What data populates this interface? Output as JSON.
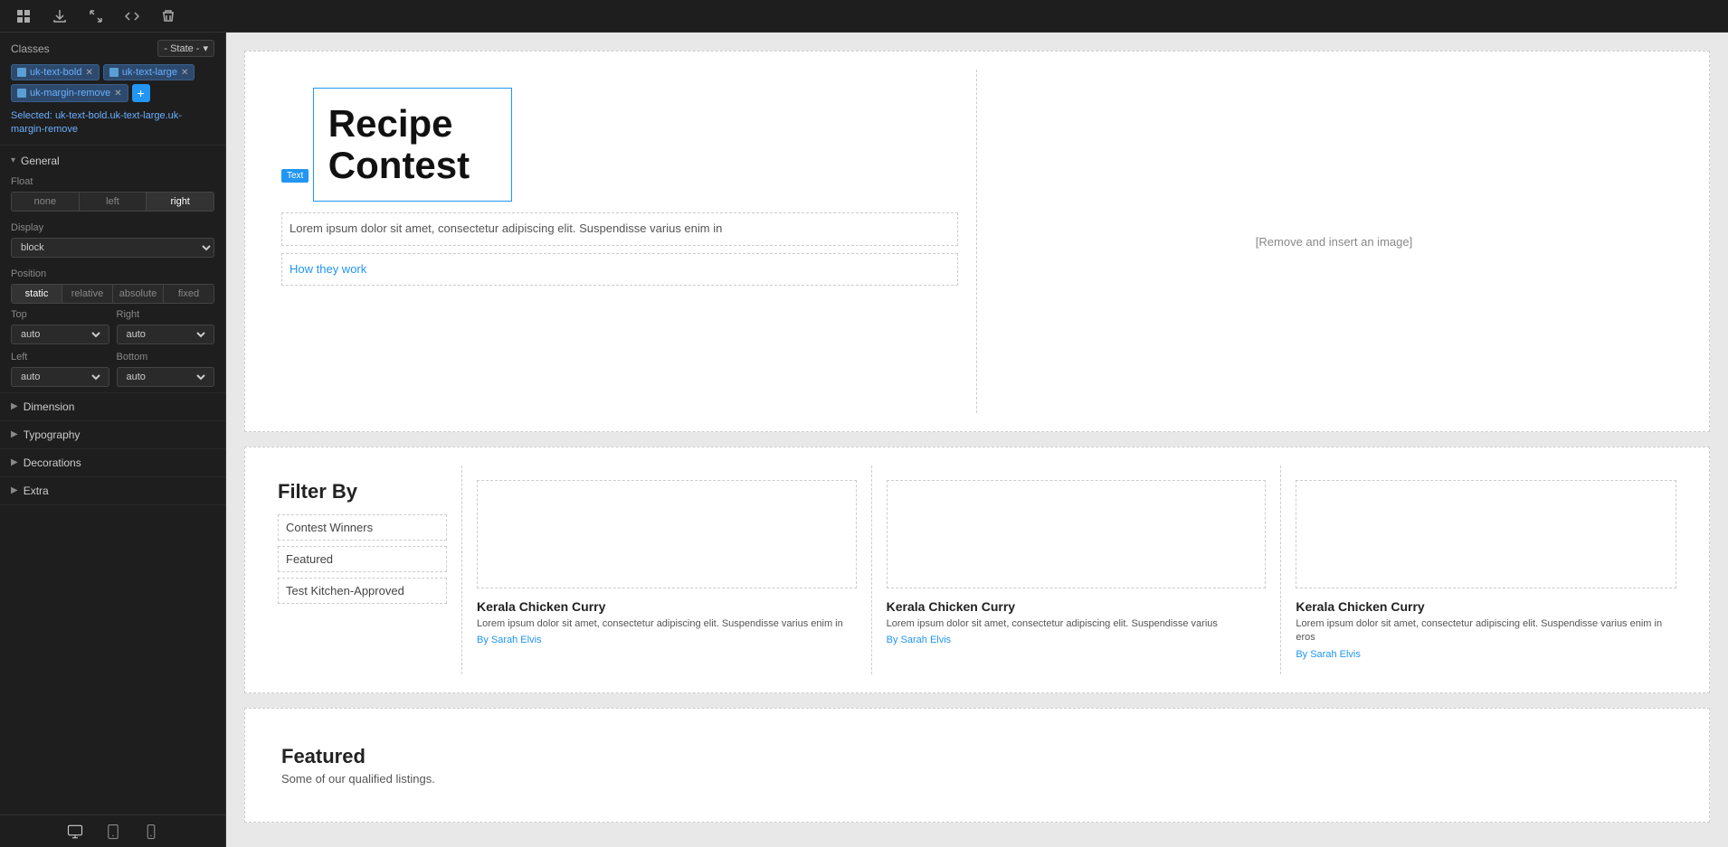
{
  "toolbar": {
    "icons": [
      "grid-icon",
      "export-icon",
      "expand-icon",
      "code-icon",
      "delete-icon"
    ]
  },
  "left_panel": {
    "classes_label": "Classes",
    "state_label": "- State -",
    "tags": [
      {
        "icon": true,
        "label": "uk-text-bold",
        "closeable": true
      },
      {
        "icon": true,
        "label": "uk-text-large",
        "closeable": true
      },
      {
        "icon": true,
        "label": "uk-margin-remove",
        "closeable": true
      }
    ],
    "add_button_label": "+",
    "selected_label": "Selected:",
    "selected_value": "uk-text-bold.uk-text-large.uk-margin-remove",
    "general_section": {
      "label": "General",
      "float": {
        "label": "Float",
        "options": [
          "none",
          "left",
          "right"
        ],
        "active": "right"
      },
      "display": {
        "label": "Display",
        "value": "block"
      },
      "position": {
        "label": "Position",
        "options": [
          "static",
          "relative",
          "absolute",
          "fixed"
        ],
        "active": "static"
      },
      "top": {
        "label": "Top",
        "value": "auto"
      },
      "right": {
        "label": "Right",
        "value": "auto"
      },
      "left": {
        "label": "Left",
        "value": "auto"
      },
      "bottom": {
        "label": "Bottom",
        "value": "auto"
      }
    },
    "dimension_section": {
      "label": "Dimension"
    },
    "typography_section": {
      "label": "Typography"
    },
    "decorations_section": {
      "label": "Decorations"
    },
    "extra_section": {
      "label": "Extra"
    }
  },
  "canvas": {
    "hero": {
      "text_label": "Text",
      "title": "Recipe Contest",
      "body": "Lorem ipsum dolor sit amet, consectetur adipiscing elit. Suspendisse varius enim in",
      "link": "How they work",
      "image_placeholder": "[Remove and insert an image]"
    },
    "filter": {
      "title": "Filter By",
      "items": [
        "Contest Winners",
        "Featured",
        "Test Kitchen-Approved"
      ],
      "cards": [
        {
          "title": "Kerala Chicken Curry",
          "desc": "Lorem ipsum dolor sit amet, consectetur adipiscing elit. Suspendisse varius enim in",
          "author": "By Sarah Elvis"
        },
        {
          "title": "Kerala Chicken Curry",
          "desc": "Lorem ipsum dolor sit amet, consectetur adipiscing elit. Suspendisse varius",
          "author": "By Sarah Elvis"
        },
        {
          "title": "Kerala Chicken Curry",
          "desc": "Lorem ipsum dolor sit amet, consectetur adipiscing elit. Suspendisse varius enim in eros",
          "author": "By Sarah Elvis"
        }
      ]
    },
    "featured": {
      "title": "Featured",
      "subtitle": "Some of our qualified listings."
    }
  },
  "bottom_toolbar": {
    "devices": [
      "desktop-icon",
      "tablet-icon",
      "mobile-icon"
    ]
  }
}
